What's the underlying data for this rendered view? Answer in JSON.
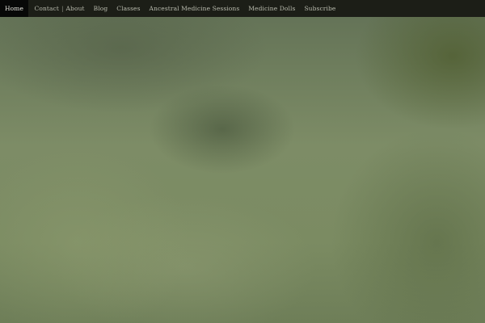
{
  "navbar": {
    "items": [
      {
        "label": "Home",
        "active": true
      },
      {
        "label": "Contact"
      },
      {
        "label": "About"
      },
      {
        "label": "Blog"
      },
      {
        "label": "Classes"
      },
      {
        "label": "Ancestral Medicine Sessions"
      },
      {
        "label": "Medicine Dolls"
      },
      {
        "label": "Subscribe"
      }
    ],
    "separator": "|"
  },
  "colors": {
    "navbar_bg": "#1c1e17",
    "active_bg": "#070807",
    "nav_text": "#b9bbae",
    "background": "#6f7f58"
  }
}
